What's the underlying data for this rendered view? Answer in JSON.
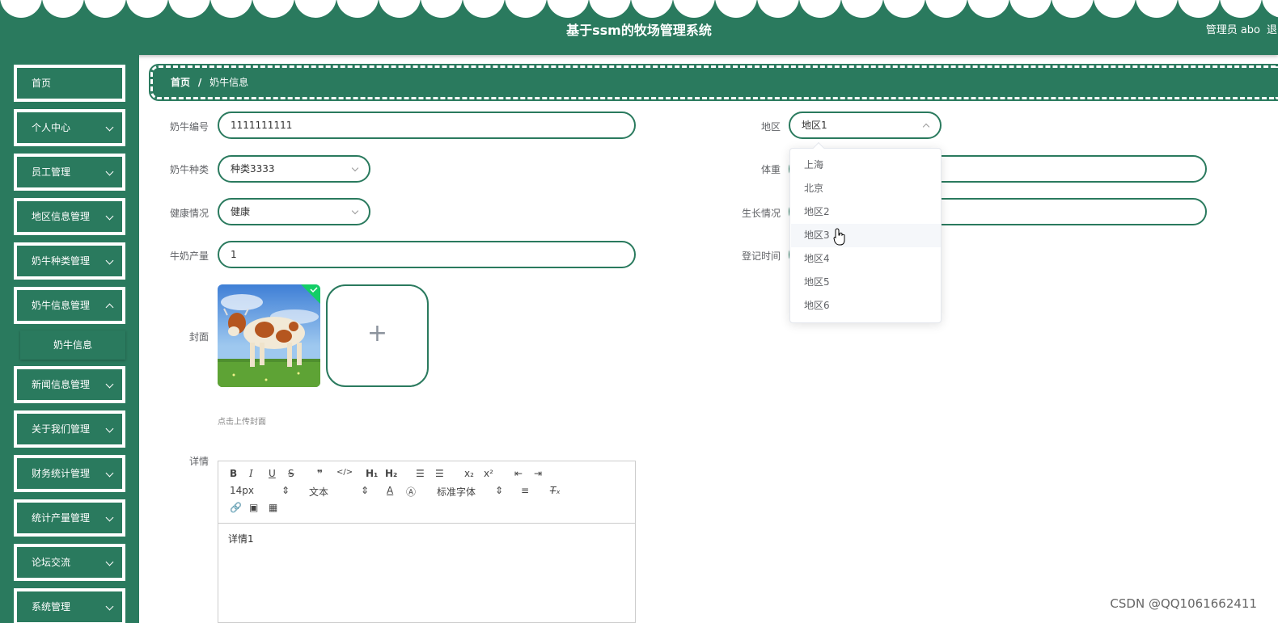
{
  "header": {
    "title": "基于ssm的牧场管理系统",
    "user_label": "管理员 abo",
    "logout_label": "退出登录"
  },
  "sidebar": {
    "items": [
      {
        "label": "首页",
        "has_children": false
      },
      {
        "label": "个人中心",
        "has_children": true
      },
      {
        "label": "员工管理",
        "has_children": true
      },
      {
        "label": "地区信息管理",
        "has_children": true
      },
      {
        "label": "奶牛种类管理",
        "has_children": true
      },
      {
        "label": "奶牛信息管理",
        "has_children": true,
        "expanded": true
      },
      {
        "label": "新闻信息管理",
        "has_children": true
      },
      {
        "label": "关于我们管理",
        "has_children": true
      },
      {
        "label": "财务统计管理",
        "has_children": true
      },
      {
        "label": "统计产量管理",
        "has_children": true
      },
      {
        "label": "论坛交流",
        "has_children": true
      },
      {
        "label": "系统管理",
        "has_children": true
      }
    ],
    "submenu_active": "奶牛信息"
  },
  "breadcrumb": {
    "home": "首页",
    "separator": "/",
    "current": "奶牛信息"
  },
  "form": {
    "cow_number_label": "奶牛编号",
    "cow_number_value": "1111111111",
    "region_label": "地区",
    "region_value": "地区1",
    "breed_label": "奶牛种类",
    "breed_value": "种类3333",
    "weight_label": "体重",
    "health_label": "健康情况",
    "health_value": "健康",
    "growth_label": "生长情况",
    "milk_label": "牛奶产量",
    "milk_value": "1",
    "register_time_label": "登记时间",
    "cover_label": "封面",
    "cover_hint": "点击上传封面",
    "detail_label": "详情",
    "detail_value": "详情1"
  },
  "editor_toolbar": {
    "font_size": "14px",
    "text_type": "文本",
    "font_family": "标准字体"
  },
  "region_dropdown": {
    "options": [
      "上海",
      "北京",
      "地区2",
      "地区3",
      "地区4",
      "地区5",
      "地区6"
    ],
    "hovered": "地区3"
  },
  "watermark": "CSDN @QQ1061662411",
  "colors": {
    "primary": "#2a7a5e",
    "background": "#ffffff",
    "text": "#606266"
  }
}
